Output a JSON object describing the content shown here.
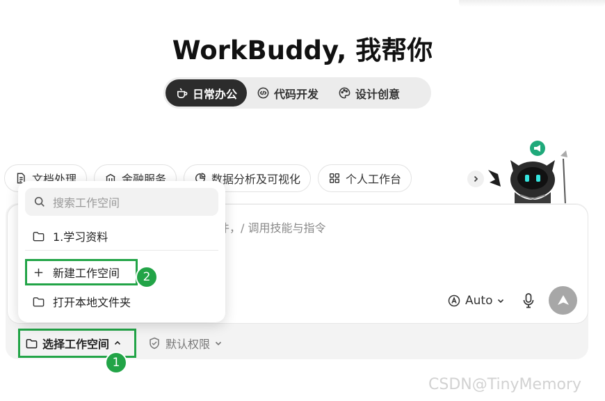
{
  "app": {
    "title": "WorkBuddy, 我帮你"
  },
  "tabs": [
    {
      "label": "日常办公",
      "icon": "coffee-icon",
      "active": true
    },
    {
      "label": "代码开发",
      "icon": "code-icon",
      "active": false
    },
    {
      "label": "设计创意",
      "icon": "palette-icon",
      "active": false
    }
  ],
  "chips": [
    {
      "label": "文档处理",
      "icon": "document-icon"
    },
    {
      "label": "金融服务",
      "icon": "finance-icon"
    },
    {
      "label": "数据分析及可视化",
      "icon": "pie-chart-icon"
    },
    {
      "label": "个人工作台",
      "icon": "grid-icon"
    }
  ],
  "composer": {
    "placeholder_visible": "件，/ 调用技能与指令",
    "model_label": "Auto",
    "workspace_label": "选择工作空间",
    "permission_label": "默认权限"
  },
  "dropdown": {
    "search_placeholder": "搜索工作空间",
    "items": [
      {
        "label": "1.学习资料",
        "icon": "folder-icon"
      },
      {
        "label": "新建工作空间",
        "icon": "plus-icon"
      },
      {
        "label": "打开本地文件夹",
        "icon": "folder-icon"
      }
    ]
  },
  "annotations": {
    "badge_1": "1",
    "badge_2": "2"
  },
  "watermark": "CSDN@TinyMemory",
  "colors": {
    "accent_green": "#22a447",
    "active_tab": "#2c2c2c",
    "send_button": "#a7a7a7"
  }
}
